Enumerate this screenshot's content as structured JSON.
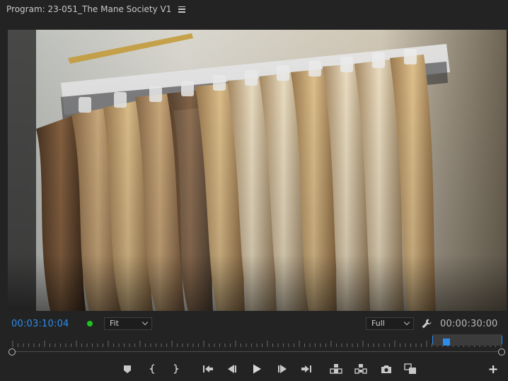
{
  "header": {
    "title": "Program: 23-051_The Mane Society V1",
    "menu_icon": "hamburger-menu-icon"
  },
  "viewer": {
    "content": "video-frame"
  },
  "controls": {
    "current_timecode": "00:03:10:04",
    "status_color": "#1ec41e",
    "zoom_select": "Fit",
    "resolution_select": "Full",
    "settings_icon": "wrench-icon",
    "duration_timecode": "00:00:30:00"
  },
  "colors": {
    "accent": "#2d8ceb",
    "background": "#232323"
  },
  "transport": {
    "buttons": [
      "add-marker-icon",
      "mark-in-icon",
      "mark-out-icon",
      "go-to-in-icon",
      "step-back-icon",
      "play-icon",
      "step-forward-icon",
      "go-to-out-icon",
      "lift-icon",
      "extract-icon",
      "export-frame-icon",
      "comparison-view-icon",
      "button-editor-icon"
    ]
  }
}
